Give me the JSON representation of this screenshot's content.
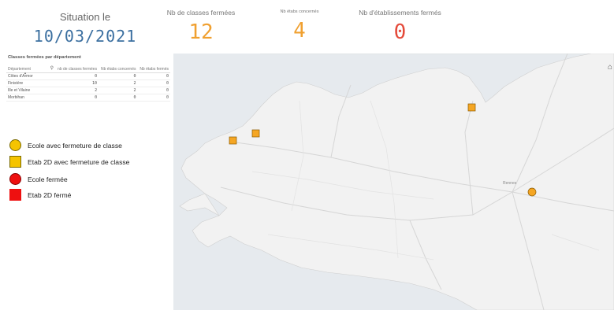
{
  "kpis": {
    "situation": {
      "label": "Situation le",
      "value": "10/03/2021"
    },
    "classes_fermees": {
      "label": "Nb de classes fermées",
      "value": "12"
    },
    "etabs_concernes": {
      "label": "Nb étabs concernés",
      "value": "4"
    },
    "etabs_fermes": {
      "label": "Nb d'établissements fermés",
      "value": "0"
    }
  },
  "table": {
    "title": "Classes fermées par département",
    "columns": [
      "Département",
      "nb de classes fermées",
      "Nb étabs concernés",
      "Nb étabs fermés"
    ],
    "rows": [
      [
        "Côtes d'Armor",
        "0",
        "0",
        "0"
      ],
      [
        "Finistère",
        "10",
        "2",
        "0"
      ],
      [
        "Ille et Vilaine",
        "2",
        "2",
        "0"
      ],
      [
        "Morbihan",
        "0",
        "0",
        "0"
      ]
    ]
  },
  "legend": [
    {
      "label": "Ecole avec fermeture de classe",
      "shape": "circle",
      "color": "#f5c400"
    },
    {
      "label": "Etab 2D avec fermeture de classe",
      "shape": "square",
      "color": "#f5c400"
    },
    {
      "label": "Ecole fermée",
      "shape": "circle",
      "color": "#ee1010"
    },
    {
      "label": "Etab 2D fermé",
      "shape": "square",
      "color": "#ee1010"
    }
  ],
  "map": {
    "city_label": "Rennes",
    "marker_color": "#f5a623",
    "icon": "home-icon"
  }
}
